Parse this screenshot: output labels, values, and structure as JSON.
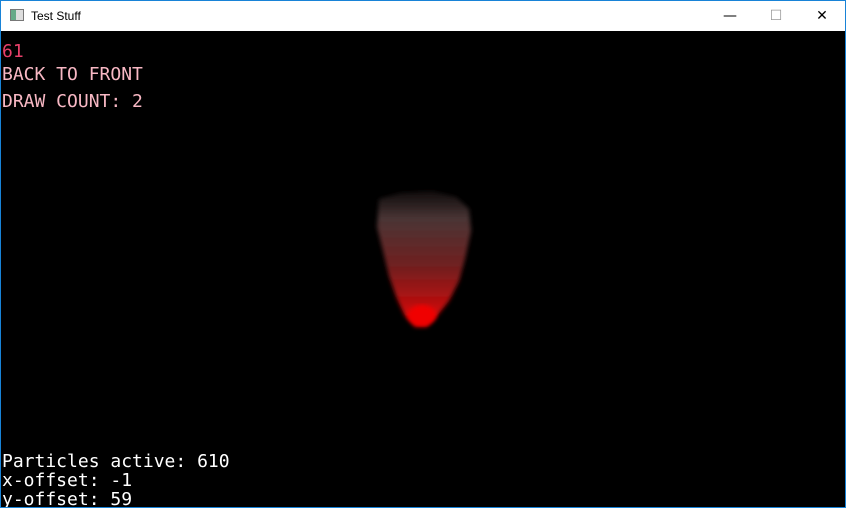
{
  "window": {
    "title": "Test Stuff",
    "minimize": "—",
    "maximize": "☐",
    "close": "✕"
  },
  "hud": {
    "fps": "61",
    "mode": "BACK TO FRONT",
    "draw_count": "DRAW COUNT: 2"
  },
  "stats": {
    "particles": "Particles active: 610",
    "x_offset": "x-offset: -1",
    "y_offset": "y-offset: 59"
  },
  "colors": {
    "fps": "#e8406a",
    "hud": "#f8b8c4",
    "particle_core": "#ee0000",
    "particle_smoke": "#4a3535"
  }
}
